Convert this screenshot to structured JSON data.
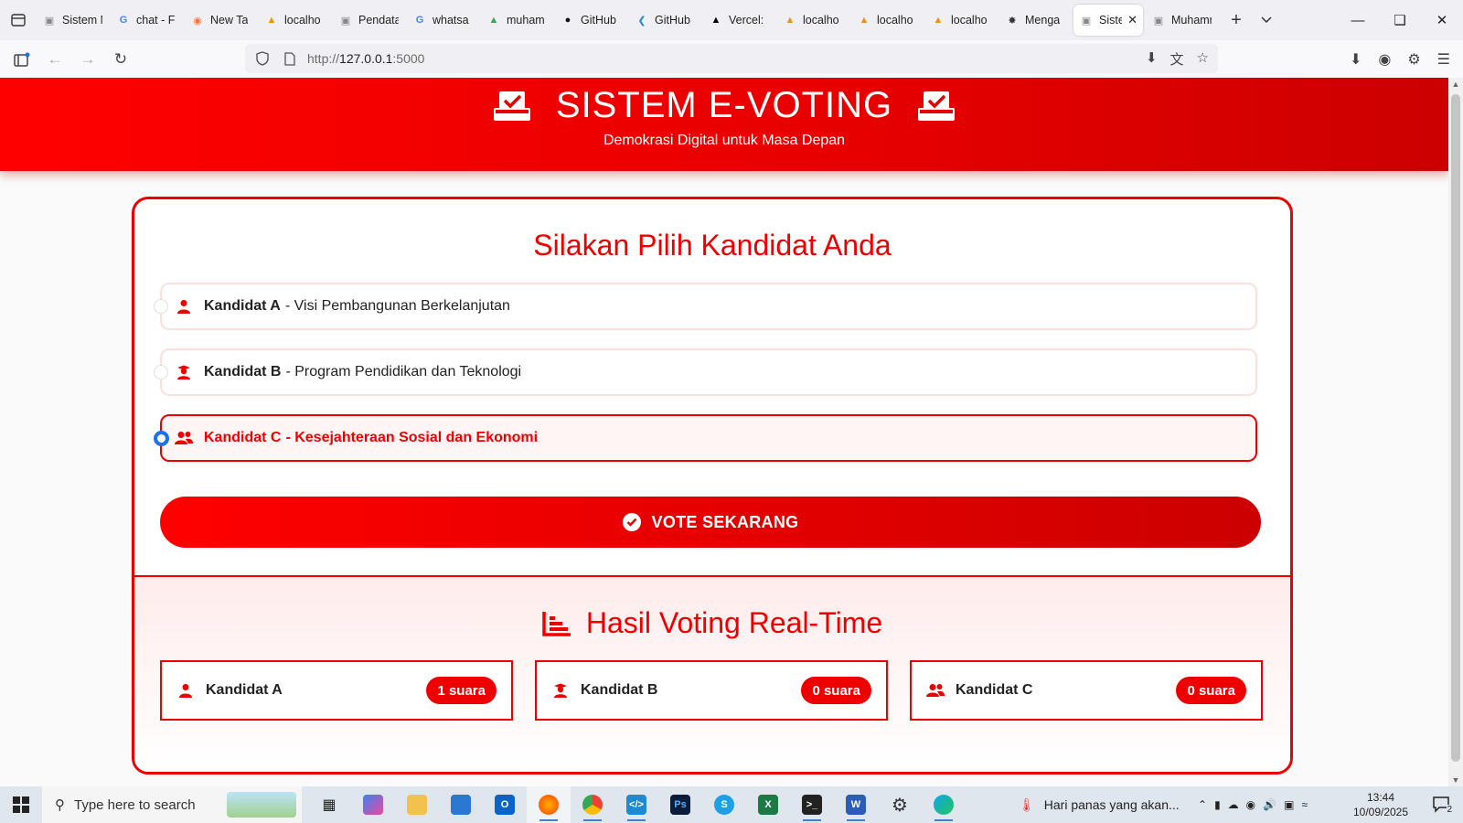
{
  "browser": {
    "tabs": [
      {
        "label": "Sistem Mar",
        "icon": "page-icon",
        "active": false
      },
      {
        "label": "chat - F",
        "icon": "google-icon",
        "active": false
      },
      {
        "label": "New Ta",
        "icon": "firefox-icon",
        "active": false
      },
      {
        "label": "localho",
        "icon": "phpmyadmin-icon",
        "active": false
      },
      {
        "label": "Pendataan",
        "icon": "page-icon",
        "active": false
      },
      {
        "label": "whatsa",
        "icon": "google-icon",
        "active": false
      },
      {
        "label": "muham",
        "icon": "drive-icon",
        "active": false
      },
      {
        "label": "GitHub",
        "icon": "github-icon",
        "active": false
      },
      {
        "label": "GitHub",
        "icon": "vscode-icon",
        "active": false
      },
      {
        "label": "Vercel:",
        "icon": "vercel-icon",
        "active": false
      },
      {
        "label": "localho",
        "icon": "phpmyadmin-icon",
        "active": false
      },
      {
        "label": "localho",
        "icon": "phpmyadmin-icon",
        "active": false
      },
      {
        "label": "localho",
        "icon": "phpmyadmin-icon",
        "active": false
      },
      {
        "label": "Menga",
        "icon": "openai-icon",
        "active": false
      },
      {
        "label": "Sistem E",
        "icon": "page-icon",
        "active": true
      },
      {
        "label": "Muhamma",
        "icon": "page-icon",
        "active": false
      }
    ],
    "url_prefix": "http://",
    "url_host": "127.0.0.1",
    "url_suffix": ":5000"
  },
  "header": {
    "title": "SISTEM E-VOTING",
    "subtitle": "Demokrasi Digital untuk Masa Depan"
  },
  "ballot": {
    "heading": "Silakan Pilih Kandidat Anda",
    "options": [
      {
        "name": "Kandidat A",
        "desc": "- Visi Pembangunan Berkelanjutan",
        "icon": "user-icon",
        "selected": false
      },
      {
        "name": "Kandidat B",
        "desc": "- Program Pendidikan dan Teknologi",
        "icon": "graduate-icon",
        "selected": false
      },
      {
        "name": "Kandidat C",
        "desc": "- Kesejahteraan Sosial dan Ekonomi",
        "icon": "users-icon",
        "selected": true
      }
    ],
    "vote_button": "VOTE SEKARANG"
  },
  "results": {
    "heading": "Hasil Voting Real-Time",
    "items": [
      {
        "name": "Kandidat A",
        "votes": "1 suara",
        "icon": "user-icon"
      },
      {
        "name": "Kandidat B",
        "votes": "0 suara",
        "icon": "graduate-icon"
      },
      {
        "name": "Kandidat C",
        "votes": "0 suara",
        "icon": "users-icon"
      }
    ]
  },
  "taskbar": {
    "search_placeholder": "Type here to search",
    "weather_text": "Hari panas yang akan...",
    "time": "13:44",
    "date": "10/09/2025",
    "notification_count": "2"
  },
  "colors": {
    "accent": "#ee0000",
    "header_gradient_start": "#ff0000",
    "header_gradient_end": "#cc0000",
    "radio_selected": "#1a73e8"
  }
}
